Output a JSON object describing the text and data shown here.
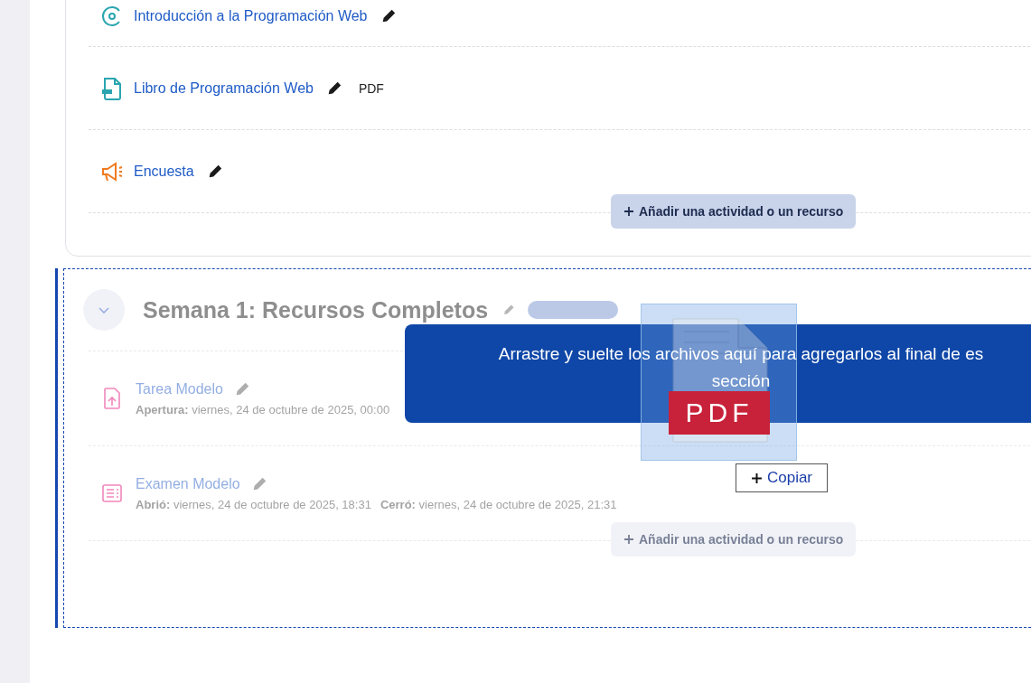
{
  "course_section": {
    "activities": [
      {
        "kind": "lesson",
        "name": "Introducción a la Programación Web"
      },
      {
        "kind": "pdf",
        "name": "Libro de Programación Web",
        "type_label": "PDF"
      },
      {
        "kind": "survey",
        "name": "Encuesta"
      }
    ],
    "add_button": "Añadir una actividad o un recurso"
  },
  "drop_section": {
    "title": "Semana 1: Recursos Completos",
    "expanded": true,
    "dimmed": true,
    "activities": [
      {
        "kind": "assignment",
        "name": "Tarea Modelo",
        "dates": [
          "**Apertura:** viernes, 24 de octubre de 2025, 00:00"
        ]
      },
      {
        "kind": "quiz",
        "name": "Examen Modelo",
        "dates": [
          "**Abrió:** viernes, 24 de octubre de 2025, 18:31",
          "**Cerró:** viernes, 24 de octubre de 2025, 21:31"
        ]
      }
    ],
    "add_button": "Añadir una actividad o un recurso"
  },
  "drop_message": {
    "lines": [
      "Arrastre y suelte los archivos aquí para agregarlos al final de es",
      "sección"
    ]
  },
  "drag_preview": {
    "file_label": "PDF",
    "action": "Copiar"
  }
}
